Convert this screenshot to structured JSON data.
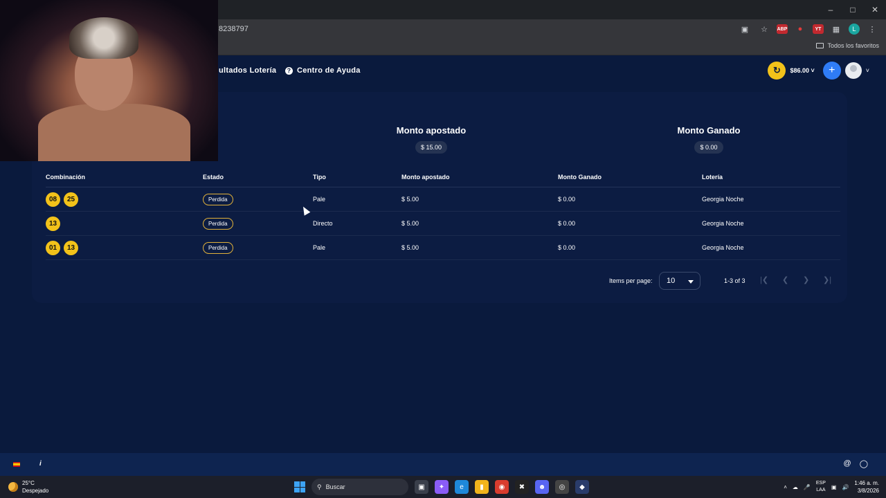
{
  "browser": {
    "url_fragment": "8238797",
    "bookmarks_all": "Todos los favoritos",
    "window_controls": [
      "minimize-icon",
      "maximize-icon",
      "close-icon"
    ],
    "extension_abp": "ABP",
    "extension_yt": "YT",
    "profile_initial": "L"
  },
  "header": {
    "nav": [
      {
        "label": "ultados Lotería"
      },
      {
        "label": "Centro de Ayuda"
      }
    ],
    "help_glyph": "?",
    "balance": "$86.00",
    "add_glyph": "+",
    "accent_yellow": "#f2c21a",
    "accent_blue": "#2f7cf6"
  },
  "summary": {
    "apostado_title": "Monto apostado",
    "apostado_value": "$ 15.00",
    "ganado_title": "Monto Ganado",
    "ganado_value": "$ 0.00"
  },
  "table": {
    "headers": [
      "Combinación",
      "Estado",
      "Tipo",
      "Monto apostado",
      "Monto Ganado",
      "Lotería"
    ],
    "rows": [
      {
        "balls": [
          "08",
          "25"
        ],
        "estado": "Perdida",
        "tipo": "Pale",
        "apostado": "$ 5.00",
        "ganado": "$ 0.00",
        "loteria": "Georgia Noche"
      },
      {
        "balls": [
          "13"
        ],
        "estado": "Perdida",
        "tipo": "Directo",
        "apostado": "$ 5.00",
        "ganado": "$ 0.00",
        "loteria": "Georgia Noche"
      },
      {
        "balls": [
          "01",
          "13"
        ],
        "estado": "Perdida",
        "tipo": "Pale",
        "apostado": "$ 5.00",
        "ganado": "$ 0.00",
        "loteria": "Georgia Noche"
      }
    ]
  },
  "pager": {
    "label": "Items per page:",
    "page_size": "10",
    "range": "1-3 of 3"
  },
  "footer": {
    "info_glyph": "i"
  },
  "taskbar": {
    "temp": "25°C",
    "weather": "Despejado",
    "search": "Buscar",
    "lang": "ESP",
    "layout": "LAA",
    "time": "1:46 a. m.",
    "date": "3/8/2026"
  }
}
